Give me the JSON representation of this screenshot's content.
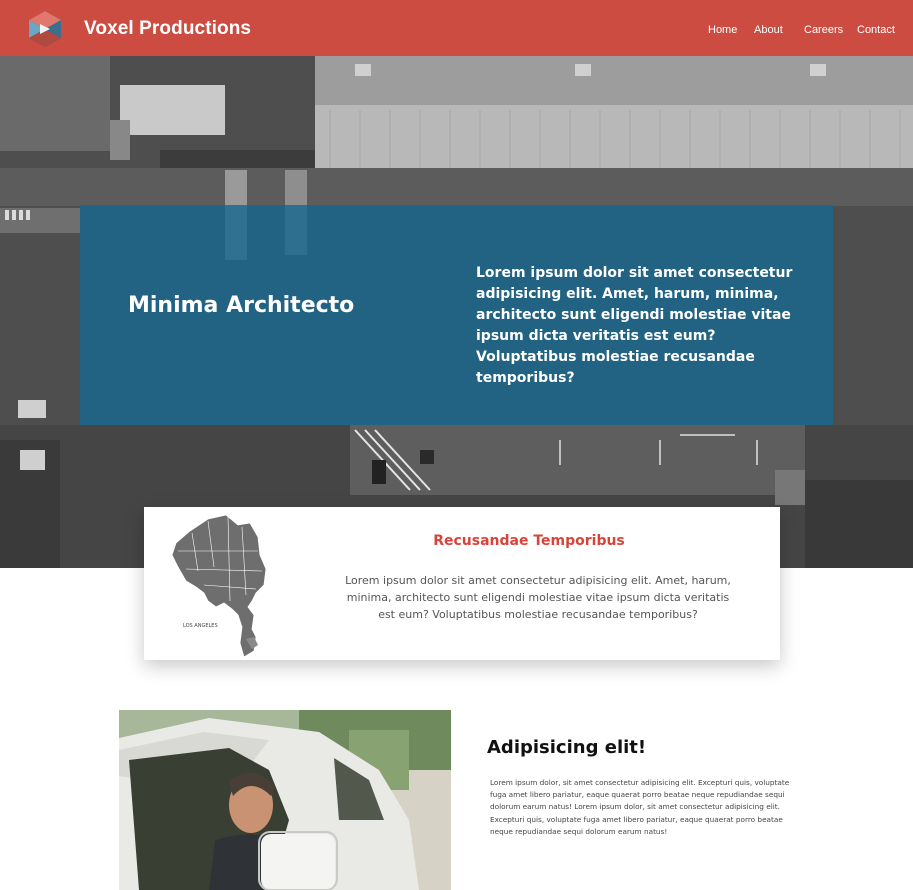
{
  "header": {
    "brand": "Voxel Productions",
    "nav": [
      "Home",
      "About",
      "Careers",
      "Contact"
    ]
  },
  "hero": {
    "title": "Minima Architecto",
    "text": "Lorem ipsum dolor sit amet consectetur adipisicing elit. Amet, harum, minima, architecto sunt eligendi molestiae vitae ipsum dicta veritatis est eum? Voluptatibus molestiae recusandae temporibus?"
  },
  "card": {
    "map_label": "LOS ANGELES",
    "title": "Recusandae Temporibus",
    "text": "Lorem ipsum dolor sit amet consectetur adipisicing elit. Amet, harum, minima, architecto sunt eligendi molestiae vitae ipsum dicta veritatis est eum? Voluptatibus molestiae recusandae temporibus?"
  },
  "section": {
    "title": "Adipisicing elit!",
    "text": "Lorem ipsum dolor, sit amet consectetur adipisicing elit. Excepturi quis, voluptate fuga amet libero pariatur, eaque quaerat porro beatae neque repudiandae sequi dolorum earum natus! Lorem ipsum dolor, sit amet consectetur adipisicing elit. Excepturi quis, voluptate fuga amet libero pariatur, eaque quaerat porro beatae neque repudiandae sequi dolorum earum natus!"
  },
  "colors": {
    "header": "#d64c42",
    "overlay": "#18688f",
    "accent": "#d9443a"
  },
  "icons": {
    "logo": "cube-logo-icon",
    "map": "los-angeles-map-icon"
  }
}
